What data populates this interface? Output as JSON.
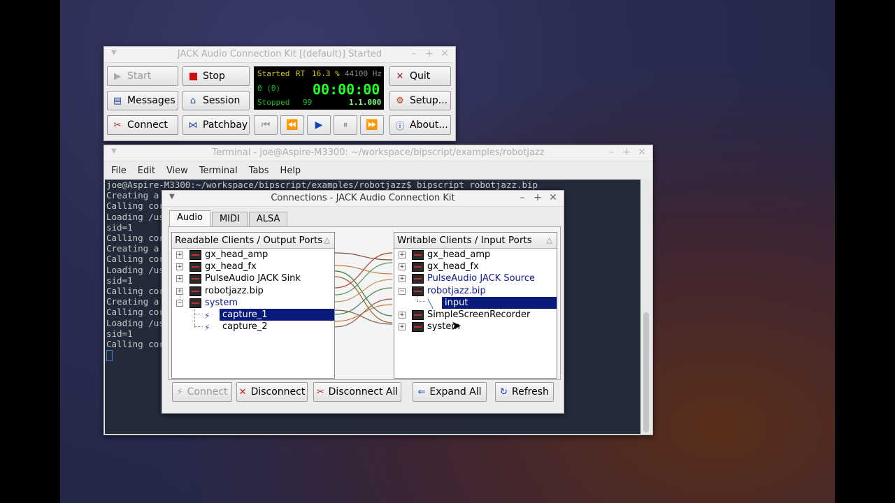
{
  "jack": {
    "title": "JACK Audio Connection Kit [(default)] Started",
    "buttons": {
      "start": "Start",
      "stop": "Stop",
      "quit": "Quit",
      "messages": "Messages",
      "session": "Session",
      "setup": "Setup...",
      "connect": "Connect",
      "patchbay": "Patchbay",
      "about": "About..."
    },
    "lcd": {
      "status": "Started",
      "rt": "RT",
      "dsp": "16.3 %",
      "rate": "44100 Hz",
      "xruns": "0 (0)",
      "time": "00:00:00",
      "transport": "Stopped",
      "bpm": "99",
      "bbt": "1.1.000"
    }
  },
  "terminal": {
    "title": "Terminal - joe@Aspire-M3300: ~/workspace/bipscript/examples/robotjazz",
    "menu": [
      "File",
      "Edit",
      "View",
      "Terminal",
      "Tabs",
      "Help"
    ],
    "lines": [
      "joe@Aspire-M3300:~/workspace/bipscript/examples/robotjazz$ bipscript robotjazz.bip",
      "Creating a",
      "Calling cor",
      "Loading /us",
      "sid=1",
      "Calling cor",
      "Creating a",
      "Calling cor",
      "Loading /us",
      "sid=1",
      "Calling cor",
      "Creating a",
      "Calling cor",
      "Loading /us",
      "sid=1",
      "Calling cor"
    ]
  },
  "connections": {
    "title": "Connections - JACK Audio Connection Kit",
    "tabs": [
      "Audio",
      "MIDI",
      "ALSA"
    ],
    "readable_header": "Readable Clients / Output Ports",
    "writable_header": "Writable Clients / Input Ports",
    "readable": {
      "c0": "gx_head_amp",
      "c1": "gx_head_fx",
      "c2": "PulseAudio JACK Sink",
      "c3": "robotjazz.bip",
      "c4": "system",
      "p0": "capture_1",
      "p1": "capture_2"
    },
    "writable": {
      "c0": "gx_head_amp",
      "c1": "gx_head_fx",
      "c2": "PulseAudio JACK Source",
      "c3": "robotjazz.bip",
      "p0": "input",
      "c4": "SimpleScreenRecorder",
      "c5": "system"
    },
    "buttons": {
      "connect": "Connect",
      "disconnect": "Disconnect",
      "disconnect_all": "Disconnect All",
      "expand_all": "Expand All",
      "refresh": "Refresh"
    }
  },
  "colors": {
    "selection": "#0a1a7a",
    "lcd_green": "#22ff22",
    "lcd_yellow": "#d8d000"
  }
}
